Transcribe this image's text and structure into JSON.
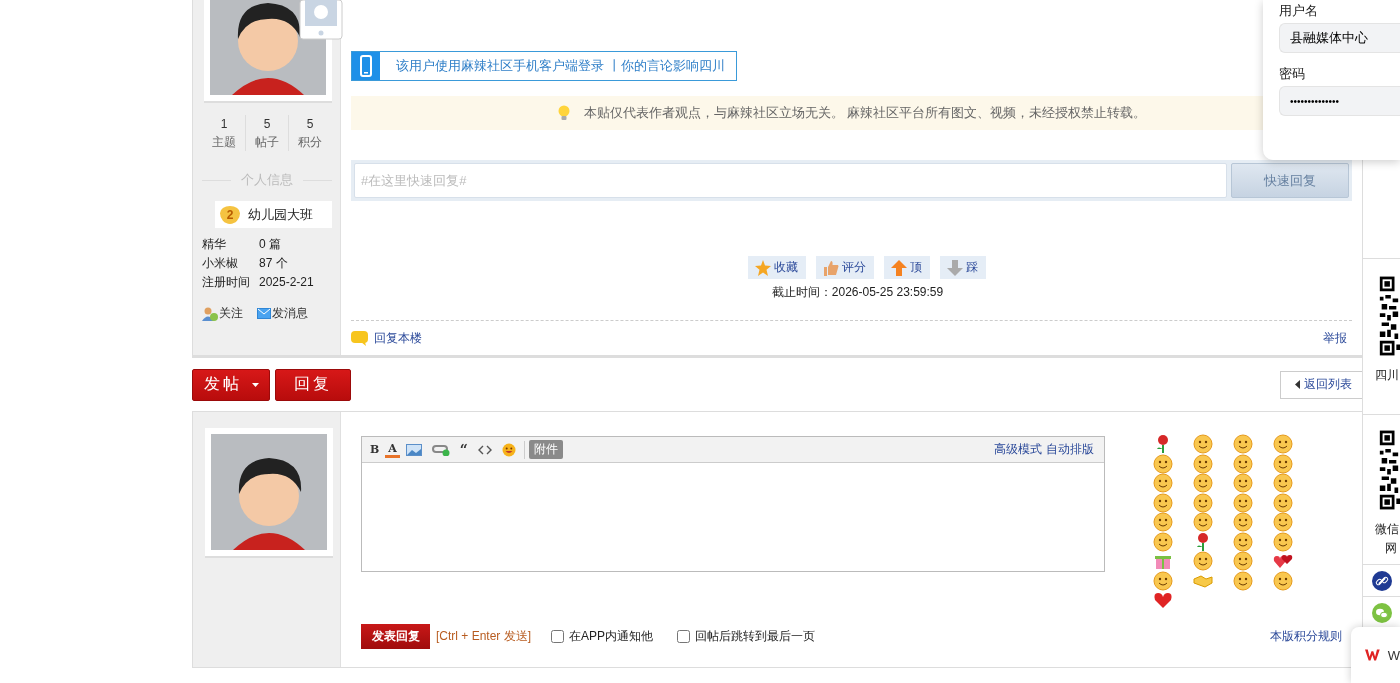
{
  "post": {
    "author": {
      "stats": [
        {
          "value": "1",
          "label": "主题"
        },
        {
          "value": "5",
          "label": "帖子"
        },
        {
          "value": "5",
          "label": "积分"
        }
      ],
      "section_title": "个人信息",
      "rank": {
        "level": "2",
        "title": "幼儿园大班"
      },
      "details": [
        {
          "label": "精华",
          "value": "0 篇"
        },
        {
          "label": "小米椒",
          "value": "87 个"
        },
        {
          "label": "注册时间",
          "value": "2025-2-21"
        }
      ],
      "actions": [
        {
          "kind": "follow",
          "label": "关注"
        },
        {
          "kind": "message",
          "label": "发消息"
        }
      ]
    },
    "mobile_banner": "该用户使用麻辣社区手机客户端登录 丨你的言论影响四川",
    "notice": "本贴仅代表作者观点，与麻辣社区立场无关。 麻辣社区平台所有图文、视频，未经授权禁止转载。",
    "quick_reply": {
      "placeholder": "#在这里快速回复#",
      "button": "快速回复"
    },
    "actions": [
      {
        "kind": "favorite",
        "label": "收藏"
      },
      {
        "kind": "rate",
        "label": "评分"
      },
      {
        "kind": "up",
        "label": "顶"
      },
      {
        "kind": "down",
        "label": "踩"
      }
    ],
    "deadline": "截止时间：2026-05-25 23:59:59",
    "reply_link": "回复本楼",
    "report_link": "举报"
  },
  "toolbar": {
    "buttons": [
      {
        "kind": "dropdown",
        "label": "发帖"
      },
      {
        "kind": "plain",
        "label": "回复"
      }
    ],
    "back_link": "返回列表"
  },
  "reply_form": {
    "tools": [
      {
        "kind": "bold",
        "label": "B"
      },
      {
        "kind": "text-color",
        "label": "A"
      },
      {
        "kind": "image"
      },
      {
        "kind": "link"
      },
      {
        "kind": "quote",
        "label": "“"
      },
      {
        "kind": "code"
      },
      {
        "kind": "smiley"
      },
      {
        "kind": "attachment",
        "label": "附件"
      }
    ],
    "mode_links": [
      "高级模式",
      "自动排版"
    ],
    "smilies": [
      {
        "kind": "rose"
      },
      {
        "kind": "face"
      },
      {
        "kind": "face"
      },
      {
        "kind": "face"
      },
      {
        "kind": "face"
      },
      {
        "kind": "face"
      },
      {
        "kind": "face"
      },
      {
        "kind": "face"
      },
      {
        "kind": "face"
      },
      {
        "kind": "face"
      },
      {
        "kind": "face"
      },
      {
        "kind": "face"
      },
      {
        "kind": "face"
      },
      {
        "kind": "face"
      },
      {
        "kind": "face"
      },
      {
        "kind": "face"
      },
      {
        "kind": "face"
      },
      {
        "kind": "face"
      },
      {
        "kind": "face"
      },
      {
        "kind": "face"
      },
      {
        "kind": "face"
      },
      {
        "kind": "rose"
      },
      {
        "kind": "face"
      },
      {
        "kind": "face"
      },
      {
        "kind": "gift"
      },
      {
        "kind": "face"
      },
      {
        "kind": "face"
      },
      {
        "kind": "hearts"
      },
      {
        "kind": "face"
      },
      {
        "kind": "handshake"
      },
      {
        "kind": "face"
      },
      {
        "kind": "face"
      },
      {
        "kind": "heart"
      }
    ],
    "submit": "发表回复",
    "shortcut": "[Ctrl + Enter 发送]",
    "options": [
      {
        "label": "在APP内通知他",
        "checked": false
      },
      {
        "label": "回帖后跳转到最后一页",
        "checked": false
      }
    ],
    "rules_link": "本版积分规则"
  },
  "side_panel": {
    "qr_caption": "四川",
    "wechat_caption": "微信",
    "wechat_caption_2": "网"
  },
  "login_popup": {
    "username_label": "用户名",
    "username": "县融媒体中心",
    "password_label": "密码",
    "password": "••••••••••••••"
  },
  "wps_popup": {
    "text": "W"
  }
}
